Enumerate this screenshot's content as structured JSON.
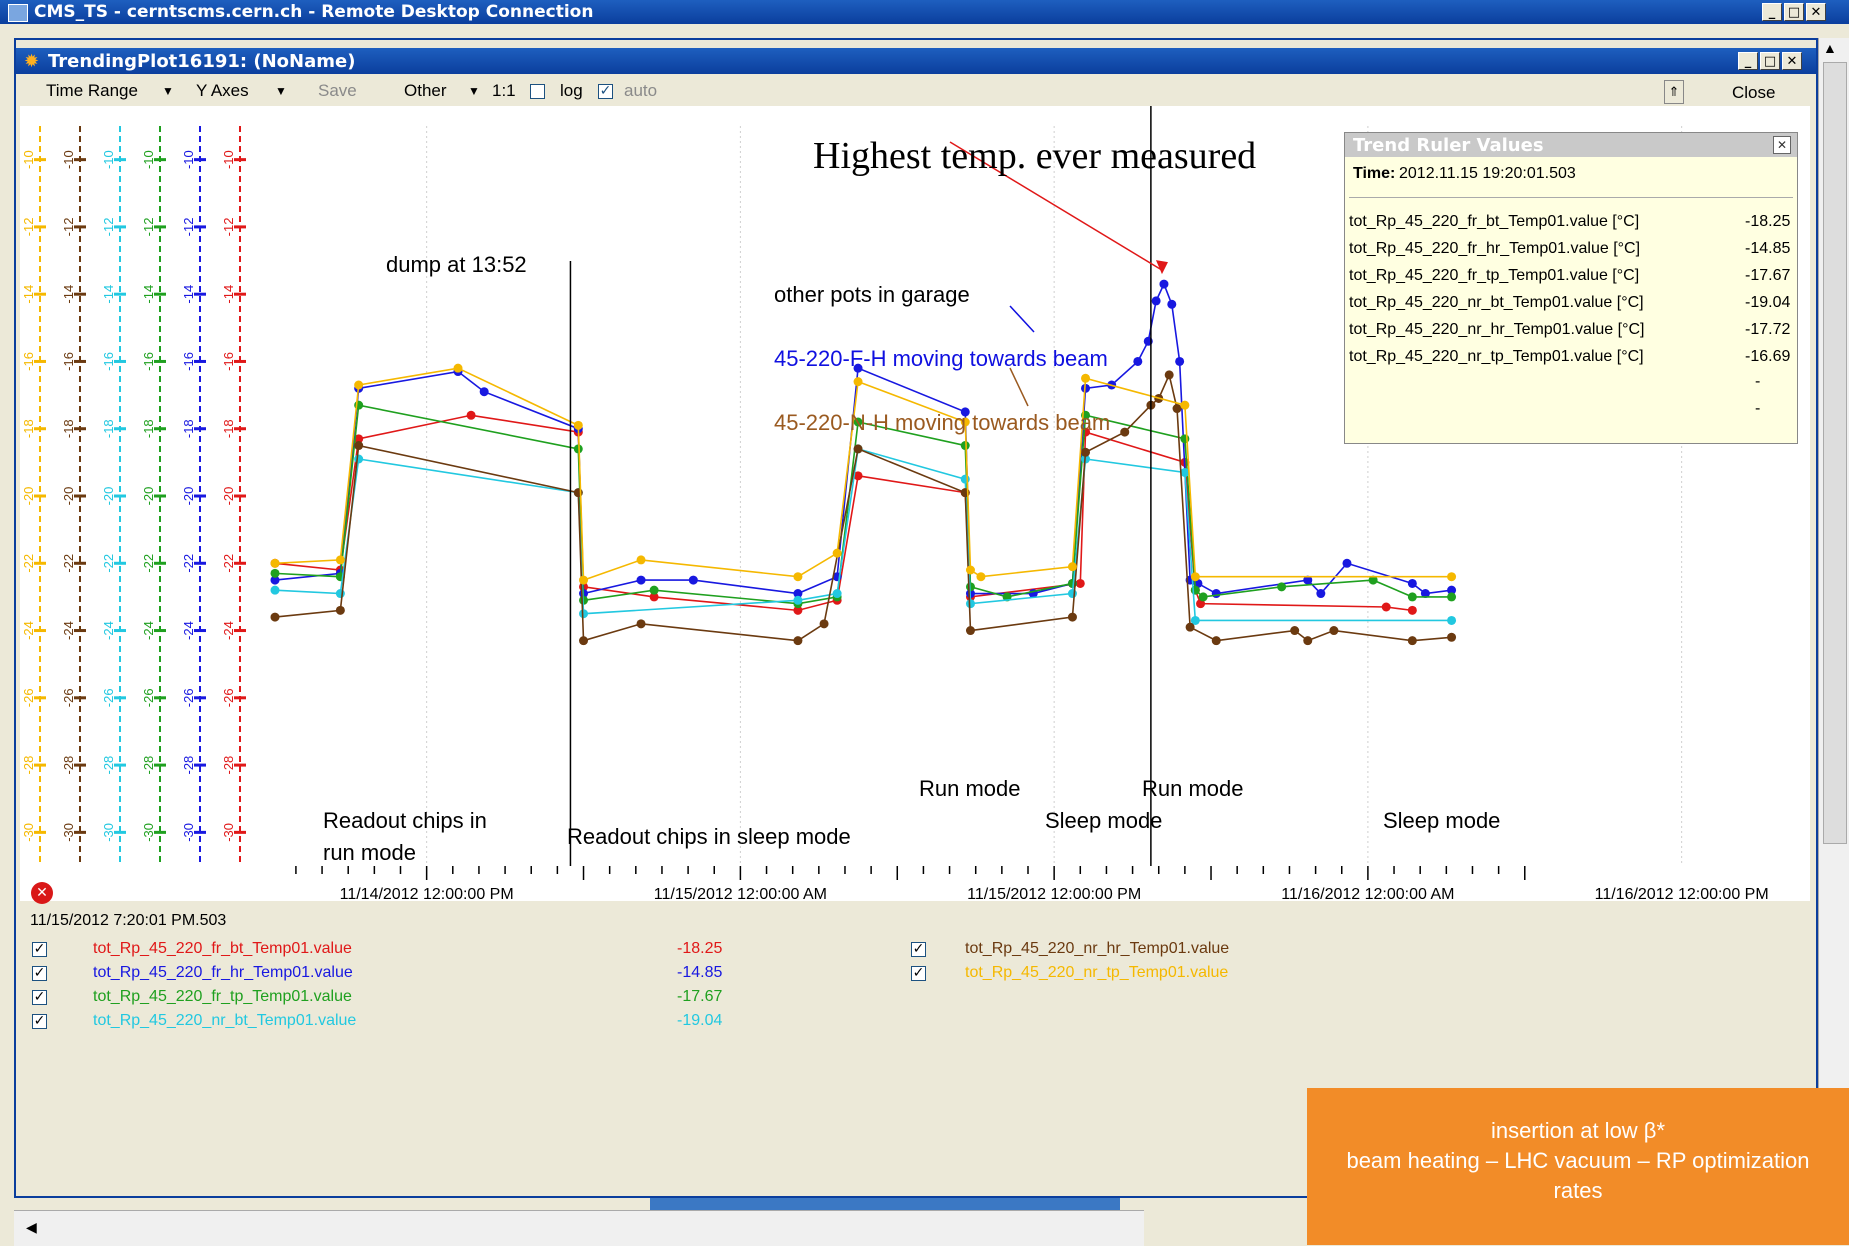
{
  "outer_window": {
    "title": "CMS_TS - cerntscms.cern.ch - Remote Desktop Connection"
  },
  "inner_window": {
    "title": "TrendingPlot16191: (NoName)"
  },
  "toolbar": {
    "time_range": "Time Range",
    "y_axes": "Y Axes",
    "save": "Save",
    "other": "Other",
    "ratio": "1:1",
    "log": "log",
    "auto": "auto",
    "close": "Close"
  },
  "chart_data": {
    "type": "line",
    "x_ticks": [
      "11/14/2012 12:00:00 PM",
      "11/15/2012 12:00:00 AM",
      "11/15/2012 12:00:00 PM",
      "11/16/2012 12:00:00 AM",
      "11/16/2012 12:00:00 PM"
    ],
    "y_ticks": [
      "-10",
      "-12",
      "-14",
      "-16",
      "-18",
      "-20",
      "-22",
      "-24",
      "-26",
      "-28",
      "-30"
    ],
    "ylim": [
      -31,
      -9
    ],
    "axis_colors": [
      "#f5b800",
      "#6b3a10",
      "#22c8e0",
      "#1fa01f",
      "#1818e0",
      "#e01818"
    ],
    "series": [
      {
        "name": "tot_Rp_45_220_fr_bt_Temp01.value",
        "color": "#e01818",
        "points": [
          [
            0,
            -22.0
          ],
          [
            2.5,
            -22.2
          ],
          [
            3.2,
            -18.3
          ],
          [
            7.5,
            -17.6
          ],
          [
            11.6,
            -18.1
          ],
          [
            11.8,
            -22.7
          ],
          [
            14.5,
            -23.0
          ],
          [
            20.0,
            -23.4
          ],
          [
            21.5,
            -23.1
          ],
          [
            22.3,
            -19.4
          ],
          [
            26.4,
            -19.9
          ],
          [
            26.6,
            -23.0
          ],
          [
            30.8,
            -22.6
          ],
          [
            31.0,
            -18.1
          ],
          [
            34.8,
            -19.0
          ],
          [
            35.2,
            -22.8
          ],
          [
            35.4,
            -23.2
          ],
          [
            42.5,
            -23.3
          ],
          [
            43.5,
            -23.4
          ]
        ]
      },
      {
        "name": "tot_Rp_45_220_fr_hr_Temp01.value",
        "color": "#1818e0",
        "points": [
          [
            0,
            -22.5
          ],
          [
            2.5,
            -22.3
          ],
          [
            3.2,
            -16.8
          ],
          [
            7.0,
            -16.3
          ],
          [
            8.0,
            -16.9
          ],
          [
            11.6,
            -18.0
          ],
          [
            11.8,
            -22.9
          ],
          [
            14.0,
            -22.5
          ],
          [
            16.0,
            -22.5
          ],
          [
            20.0,
            -22.9
          ],
          [
            21.5,
            -22.4
          ],
          [
            22.3,
            -16.2
          ],
          [
            26.4,
            -17.5
          ],
          [
            26.6,
            -22.9
          ],
          [
            29.0,
            -22.9
          ],
          [
            30.5,
            -22.6
          ],
          [
            31.0,
            -16.8
          ],
          [
            32.0,
            -16.7
          ],
          [
            33.0,
            -16.0
          ],
          [
            33.4,
            -15.4
          ],
          [
            33.7,
            -14.2
          ],
          [
            34.0,
            -13.7
          ],
          [
            34.3,
            -14.3
          ],
          [
            34.6,
            -16.0
          ],
          [
            35.0,
            -22.5
          ],
          [
            35.3,
            -22.6
          ],
          [
            36.0,
            -22.9
          ],
          [
            39.5,
            -22.5
          ],
          [
            40.0,
            -22.9
          ],
          [
            41.0,
            -22.0
          ],
          [
            43.5,
            -22.6
          ],
          [
            44.0,
            -22.9
          ],
          [
            45.0,
            -22.8
          ]
        ]
      },
      {
        "name": "tot_Rp_45_220_fr_tp_Temp01.value",
        "color": "#1fa01f",
        "points": [
          [
            0,
            -22.3
          ],
          [
            2.5,
            -22.4
          ],
          [
            3.2,
            -17.3
          ],
          [
            11.6,
            -18.6
          ],
          [
            11.8,
            -23.1
          ],
          [
            14.5,
            -22.8
          ],
          [
            20.0,
            -23.2
          ],
          [
            21.5,
            -23.0
          ],
          [
            22.3,
            -17.8
          ],
          [
            26.4,
            -18.5
          ],
          [
            26.6,
            -22.7
          ],
          [
            28.0,
            -23.0
          ],
          [
            30.5,
            -22.6
          ],
          [
            31.0,
            -17.6
          ],
          [
            34.8,
            -18.3
          ],
          [
            35.2,
            -22.8
          ],
          [
            35.5,
            -23.0
          ],
          [
            38.5,
            -22.7
          ],
          [
            42.0,
            -22.5
          ],
          [
            43.5,
            -23.0
          ],
          [
            45.0,
            -23.0
          ]
        ]
      },
      {
        "name": "tot_Rp_45_220_nr_bt_Temp01.value",
        "color": "#22c8e0",
        "points": [
          [
            0,
            -22.8
          ],
          [
            2.5,
            -22.9
          ],
          [
            3.2,
            -18.9
          ],
          [
            11.6,
            -19.9
          ],
          [
            11.8,
            -23.5
          ],
          [
            20.0,
            -23.1
          ],
          [
            21.5,
            -22.9
          ],
          [
            22.3,
            -18.6
          ],
          [
            26.4,
            -19.5
          ],
          [
            26.6,
            -23.2
          ],
          [
            30.5,
            -22.9
          ],
          [
            31.0,
            -18.9
          ],
          [
            34.8,
            -19.3
          ],
          [
            35.2,
            -23.7
          ],
          [
            45.0,
            -23.7
          ]
        ]
      },
      {
        "name": "tot_Rp_45_220_nr_hr_Temp01.value",
        "color": "#6b3a10",
        "points": [
          [
            0,
            -23.6
          ],
          [
            2.5,
            -23.4
          ],
          [
            3.2,
            -18.5
          ],
          [
            11.6,
            -19.9
          ],
          [
            11.8,
            -24.3
          ],
          [
            14.0,
            -23.8
          ],
          [
            20.0,
            -24.3
          ],
          [
            21.0,
            -23.8
          ],
          [
            22.3,
            -18.6
          ],
          [
            26.4,
            -19.9
          ],
          [
            26.6,
            -24.0
          ],
          [
            30.5,
            -23.6
          ],
          [
            31.0,
            -18.7
          ],
          [
            32.5,
            -18.1
          ],
          [
            33.5,
            -17.3
          ],
          [
            33.8,
            -17.1
          ],
          [
            34.2,
            -16.4
          ],
          [
            34.5,
            -17.4
          ],
          [
            35.0,
            -23.9
          ],
          [
            36.0,
            -24.3
          ],
          [
            39.0,
            -24.0
          ],
          [
            39.5,
            -24.3
          ],
          [
            40.5,
            -24.0
          ],
          [
            43.5,
            -24.3
          ],
          [
            45.0,
            -24.2
          ]
        ]
      },
      {
        "name": "tot_Rp_45_220_nr_tp_Temp01.value",
        "color": "#f5b800",
        "points": [
          [
            0,
            -22.0
          ],
          [
            2.5,
            -21.9
          ],
          [
            3.2,
            -16.7
          ],
          [
            7.0,
            -16.2
          ],
          [
            11.6,
            -17.9
          ],
          [
            11.8,
            -22.5
          ],
          [
            14.0,
            -21.9
          ],
          [
            20.0,
            -22.4
          ],
          [
            21.5,
            -21.7
          ],
          [
            22.3,
            -16.6
          ],
          [
            26.4,
            -17.8
          ],
          [
            26.6,
            -22.2
          ],
          [
            27.0,
            -22.4
          ],
          [
            30.5,
            -22.1
          ],
          [
            31.0,
            -16.5
          ],
          [
            34.8,
            -17.3
          ],
          [
            35.2,
            -22.4
          ],
          [
            45.0,
            -22.4
          ]
        ]
      }
    ]
  },
  "annotations": {
    "highest": "Highest temp. ever measured",
    "dump": "dump at 13:52",
    "other_pots": "other pots in garage",
    "fh_moving": "45-220-F-H moving towards beam",
    "nh_moving": "45-220-N-H moving towards beam",
    "readout_run_1": "Readout chips in",
    "readout_run_2": "run mode",
    "readout_sleep": "Readout chips in sleep mode",
    "run_mode_1": "Run mode",
    "run_mode_2": "Run mode",
    "sleep_mode_1": "Sleep mode",
    "sleep_mode_2": "Sleep mode"
  },
  "trend_ruler": {
    "title": "Trend Ruler Values",
    "time_label": "Time:",
    "time_value": "2012.11.15 19:20:01.503",
    "rows": [
      {
        "name": "tot_Rp_45_220_fr_bt_Temp01.value [°C]",
        "value": "-18.25"
      },
      {
        "name": "tot_Rp_45_220_fr_hr_Temp01.value [°C]",
        "value": "-14.85"
      },
      {
        "name": "tot_Rp_45_220_fr_tp_Temp01.value [°C]",
        "value": "-17.67"
      },
      {
        "name": "tot_Rp_45_220_nr_bt_Temp01.value [°C]",
        "value": "-19.04"
      },
      {
        "name": "tot_Rp_45_220_nr_hr_Temp01.value [°C]",
        "value": "-17.72"
      },
      {
        "name": "tot_Rp_45_220_nr_tp_Temp01.value [°C]",
        "value": "-16.69"
      }
    ],
    "extra": [
      "-",
      "-"
    ]
  },
  "legend": {
    "timestamp": "11/15/2012 7:20:01 PM.503",
    "left": [
      {
        "name": "tot_Rp_45_220_fr_bt_Temp01.value",
        "value": "-18.25",
        "color": "#e01818"
      },
      {
        "name": "tot_Rp_45_220_fr_hr_Temp01.value",
        "value": "-14.85",
        "color": "#1818e0"
      },
      {
        "name": "tot_Rp_45_220_fr_tp_Temp01.value",
        "value": "-17.67",
        "color": "#1fa01f"
      },
      {
        "name": "tot_Rp_45_220_nr_bt_Temp01.value",
        "value": "-19.04",
        "color": "#22c8e0"
      }
    ],
    "right": [
      {
        "name": "tot_Rp_45_220_nr_hr_Temp01.value",
        "color": "#6b3a10"
      },
      {
        "name": "tot_Rp_45_220_nr_tp_Temp01.value",
        "color": "#f5b800"
      }
    ]
  },
  "overlay": {
    "line1": "insertion at low β*",
    "line2": "beam heating – LHC vacuum – RP optimization",
    "line3": "rates"
  }
}
